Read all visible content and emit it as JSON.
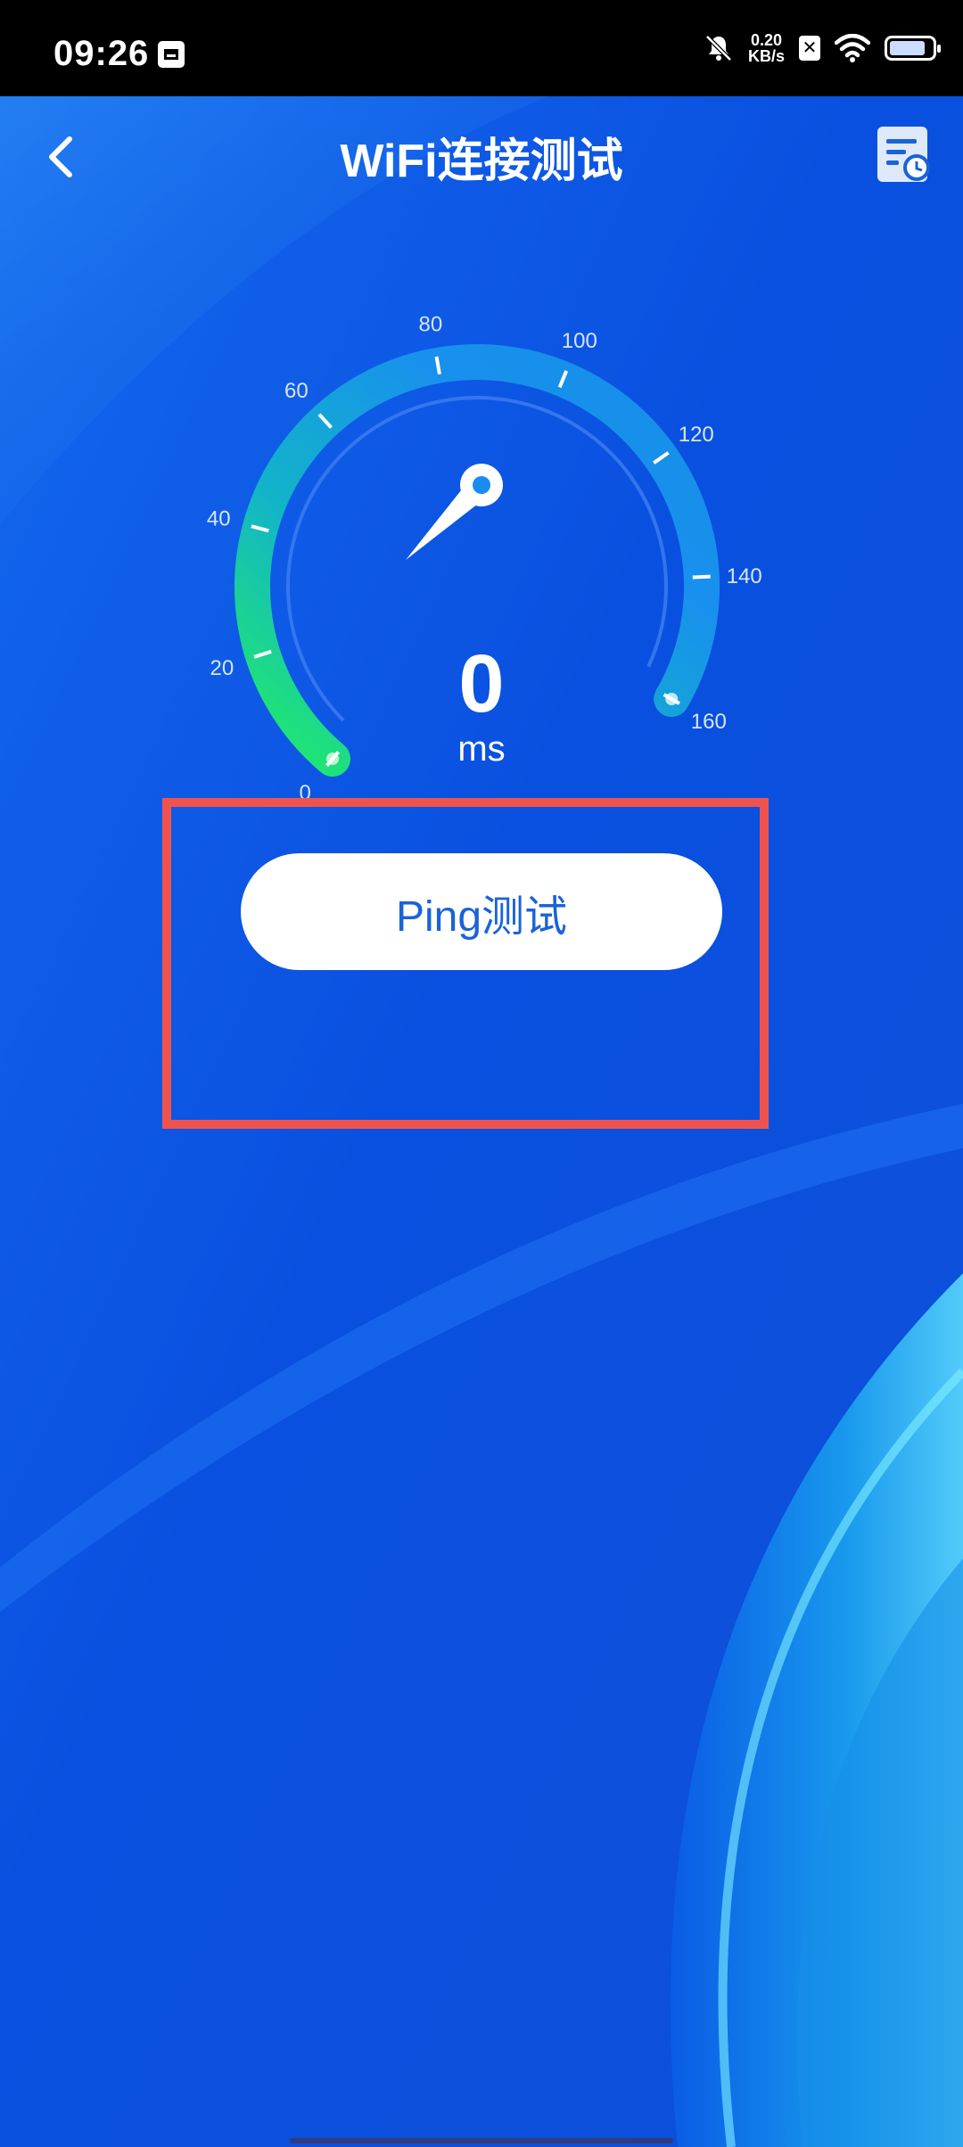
{
  "status_bar": {
    "time": "09:26",
    "net_speed_value": "0.20",
    "net_speed_unit": "KB/s",
    "battery_level_fraction": 0.85
  },
  "header": {
    "title": "WiFi连接测试",
    "back_icon": "chevron-left-icon",
    "history_icon": "history-list-icon"
  },
  "gauge": {
    "ticks": [
      "0",
      "20",
      "40",
      "60",
      "80",
      "100",
      "120",
      "140",
      "160"
    ],
    "value": "0",
    "unit": "ms",
    "needle_value": 0
  },
  "ping_button_label": "Ping测试",
  "colors": {
    "background": "#0a55e3",
    "gauge_green": "#21e36b",
    "gauge_blue": "#1a8cf0",
    "button_text": "#1a63d8",
    "highlight": "#ef5350"
  }
}
